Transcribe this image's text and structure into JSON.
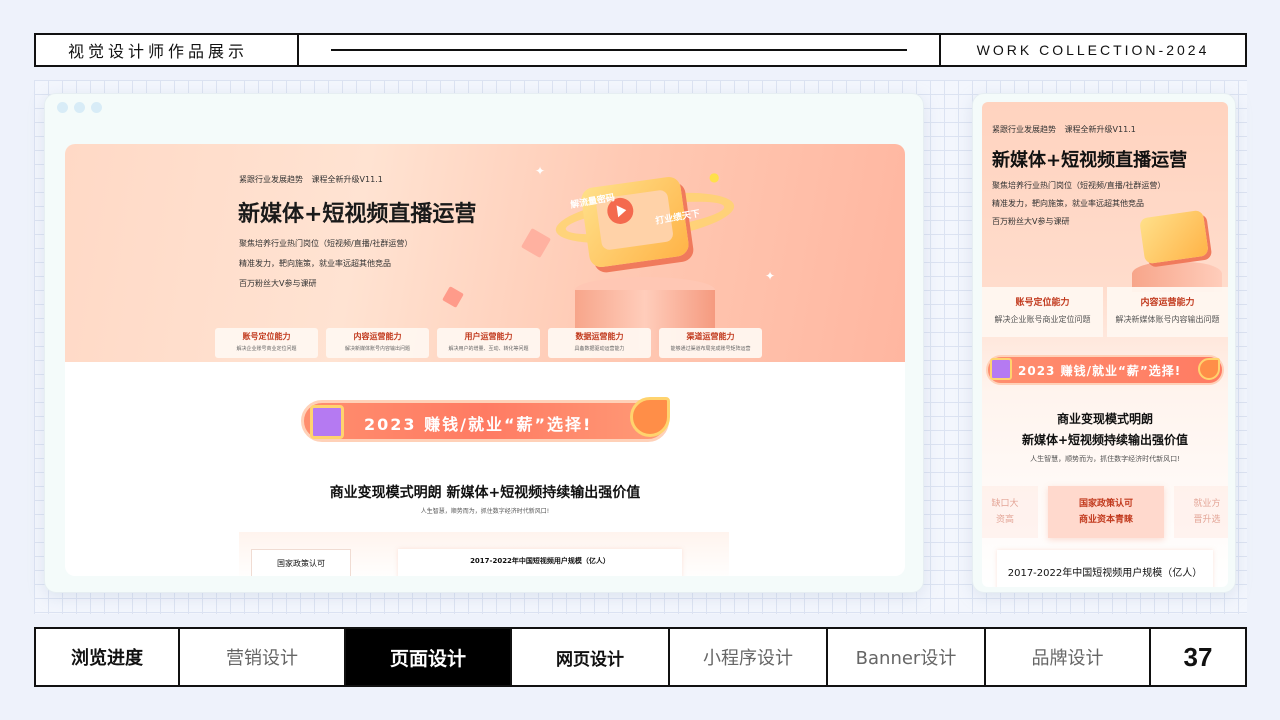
{
  "header": {
    "title": "视觉设计师作品展示",
    "collection": "WORK COLLECTION-2024"
  },
  "desktop": {
    "tags": "紧跟行业发展趋势 课程全新升级V11.1",
    "title": "新媒体+短视频直播运营",
    "desc": [
      "聚焦培养行业热门岗位（短视频/直播/社群运营）",
      "精准发力，靶向施策，就业率远超其他竞品",
      "百万粉丝大V参与课研"
    ],
    "ring_text_1": "解流量密码",
    "ring_text_2": "打业绩天下",
    "features": [
      {
        "title": "账号定位能力",
        "desc": "解决企业账号商业定位问题"
      },
      {
        "title": "内容运营能力",
        "desc": "解决新媒体账号内容输出问题"
      },
      {
        "title": "用户运营能力",
        "desc": "解决用户的增量、互动、转化等问题"
      },
      {
        "title": "数据运营能力",
        "desc": "具备数据驱动运营能力"
      },
      {
        "title": "渠道运营能力",
        "desc": "能够通过渠道布局完成账号矩阵运营"
      }
    ],
    "banner": "2023 赚钱/就业“薪”选择!",
    "biz_title": "商业变现模式明朗  新媒体+短视频持续输出强价值",
    "biz_sub": "人生智慧，顺势而为，抓住数字经济时代新风口!",
    "policy": "国家政策认可",
    "chart_title": "2017-2022年中国短视频用户规模（亿人）"
  },
  "mobile": {
    "tags": "紧跟行业发展趋势 课程全新升级V11.1",
    "title": "新媒体+短视频直播运营",
    "desc": [
      "聚焦培养行业热门岗位（短视频/直播/社群运营）",
      "精准发力，靶向施策，就业率远超其他竞品",
      "百万粉丝大V参与课研"
    ],
    "features": [
      {
        "title": "账号定位能力",
        "desc": "解决企业账号商业定位问题"
      },
      {
        "title": "内容运营能力",
        "desc": "解决新媒体账号内容输出问题"
      }
    ],
    "banner": "2023 赚钱/就业“薪”选择!",
    "biz_line1": "商业变现模式明朗",
    "biz_line2": "新媒体+短视频持续输出强价值",
    "biz_sub": "人生智慧，顺势而为，抓住数字经济时代新风口!",
    "card_center_1": "国家政策认可",
    "card_center_2": "商业资本青睐",
    "card_left_1": "缺口大",
    "card_left_2": "资高",
    "card_right_1": "就业方",
    "card_right_2": "晋升选",
    "chart_title": "2017-2022年中国短视频用户规模（亿人）"
  },
  "nav": {
    "label": "浏览进度",
    "items": [
      "营销设计",
      "页面设计",
      "网页设计",
      "小程序设计",
      "Banner设计",
      "品牌设计"
    ],
    "active": "页面设计",
    "page_number": "37"
  }
}
